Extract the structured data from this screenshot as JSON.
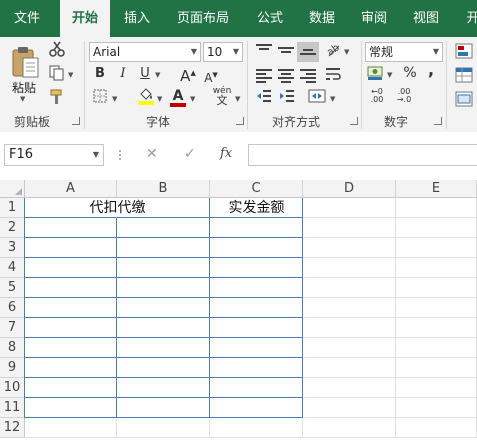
{
  "tabs": [
    "文件",
    "开始",
    "插入",
    "页面布局",
    "公式",
    "数据",
    "审阅",
    "视图",
    "开"
  ],
  "active_tab": "开始",
  "ribbon": {
    "clipboard": {
      "paste_label": "粘贴",
      "group_label": "剪贴板"
    },
    "font": {
      "font_name": "Arial",
      "font_size": "10",
      "group_label": "字体",
      "bold": "B",
      "italic": "I",
      "underline": "U",
      "grow": "A",
      "shrink": "A",
      "font_color_glyph": "A",
      "phonetic": "wén"
    },
    "alignment": {
      "group_label": "对齐方式"
    },
    "number": {
      "format": "常规",
      "group_label": "数字",
      "percent": "%",
      "comma": ","
    }
  },
  "formula_bar": {
    "name_box": "F16",
    "cancel": "✕",
    "enter": "✓",
    "fx": "fx",
    "content": ""
  },
  "columns": [
    "A",
    "B",
    "C",
    "D",
    "E"
  ],
  "rows": [
    "1",
    "2",
    "3",
    "4",
    "5",
    "6",
    "7",
    "8",
    "9",
    "10",
    "11",
    "12"
  ],
  "cells": {
    "A1": "代扣代缴",
    "C1": "实发金额"
  }
}
